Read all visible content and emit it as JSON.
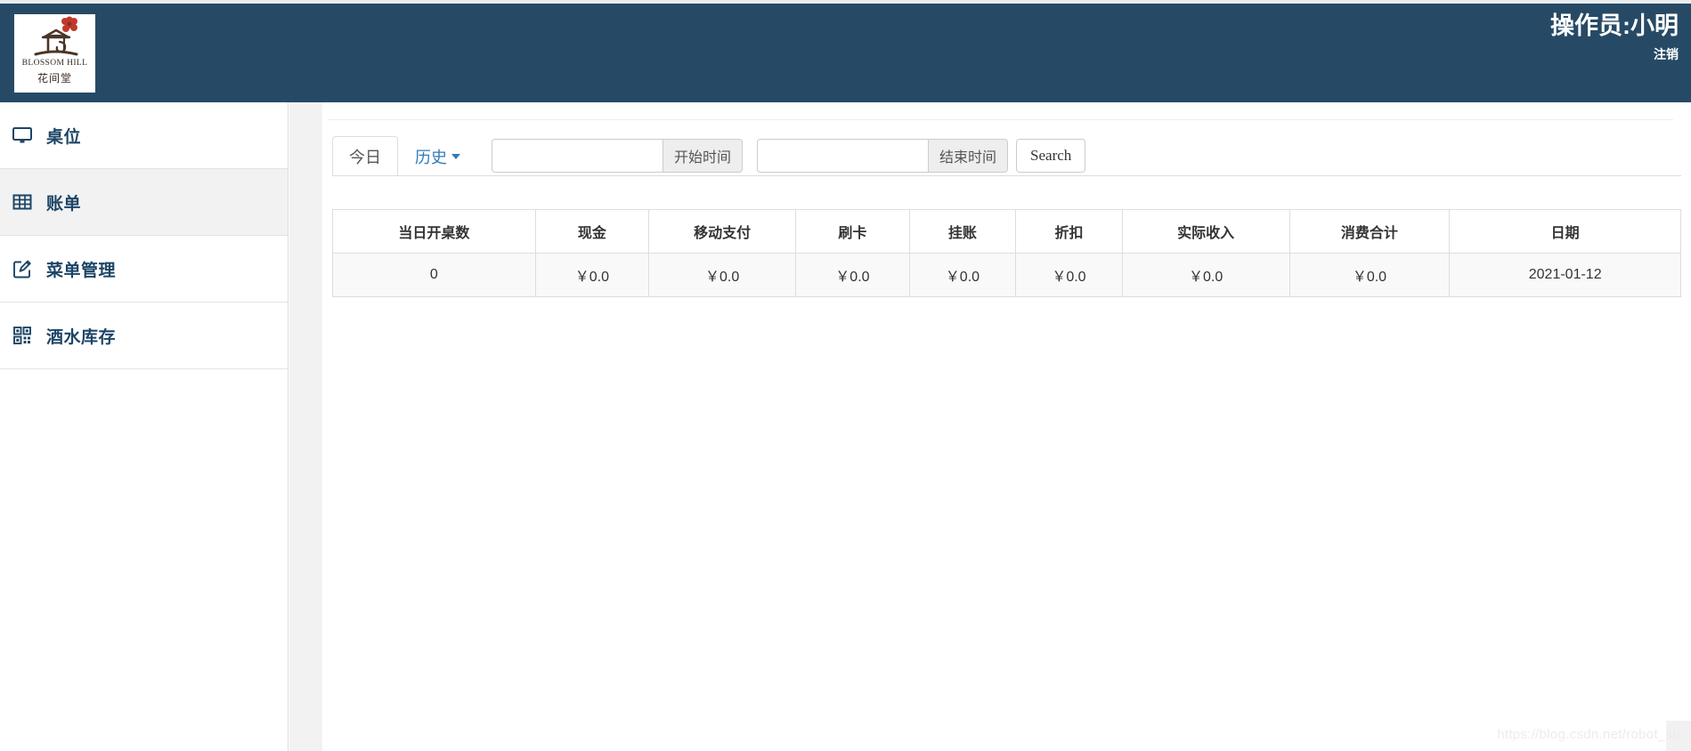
{
  "header": {
    "logo": {
      "brand_latin": "BLOSSOM HILL",
      "brand_cn": "花间堂",
      "icon": "pavilion-flower-logo"
    },
    "operator_label": "操作员:小明",
    "logout_label": "注销",
    "background_color": "#264a66"
  },
  "sidebar": {
    "items": [
      {
        "label": "桌位",
        "icon": "desktop-icon",
        "active": false
      },
      {
        "label": "账单",
        "icon": "table-grid-icon",
        "active": true
      },
      {
        "label": "菜单管理",
        "icon": "edit-square-icon",
        "active": false
      },
      {
        "label": "酒水库存",
        "icon": "qrcode-icon",
        "active": false
      }
    ],
    "accent_color": "#1c4566",
    "active_background": "#f2f2f2"
  },
  "toolbar": {
    "tabs": [
      {
        "label": "今日",
        "active": true,
        "has_caret": false
      },
      {
        "label": "历史",
        "active": false,
        "has_caret": true
      }
    ],
    "start_time": {
      "value": "",
      "placeholder": "",
      "addon_label": "开始时间"
    },
    "end_time": {
      "value": "",
      "placeholder": "",
      "addon_label": "结束时间"
    },
    "search_label": "Search"
  },
  "table": {
    "columns": [
      "当日开桌数",
      "现金",
      "移动支付",
      "刷卡",
      "挂账",
      "折扣",
      "实际收入",
      "消费合计",
      "日期"
    ],
    "rows": [
      [
        "0",
        "￥0.0",
        "￥0.0",
        "￥0.0",
        "￥0.0",
        "￥0.0",
        "￥0.0",
        "￥0.0",
        "2021-01-12"
      ]
    ]
  },
  "watermark": {
    "text": "https://blog.csdn.net/robot_sh"
  }
}
